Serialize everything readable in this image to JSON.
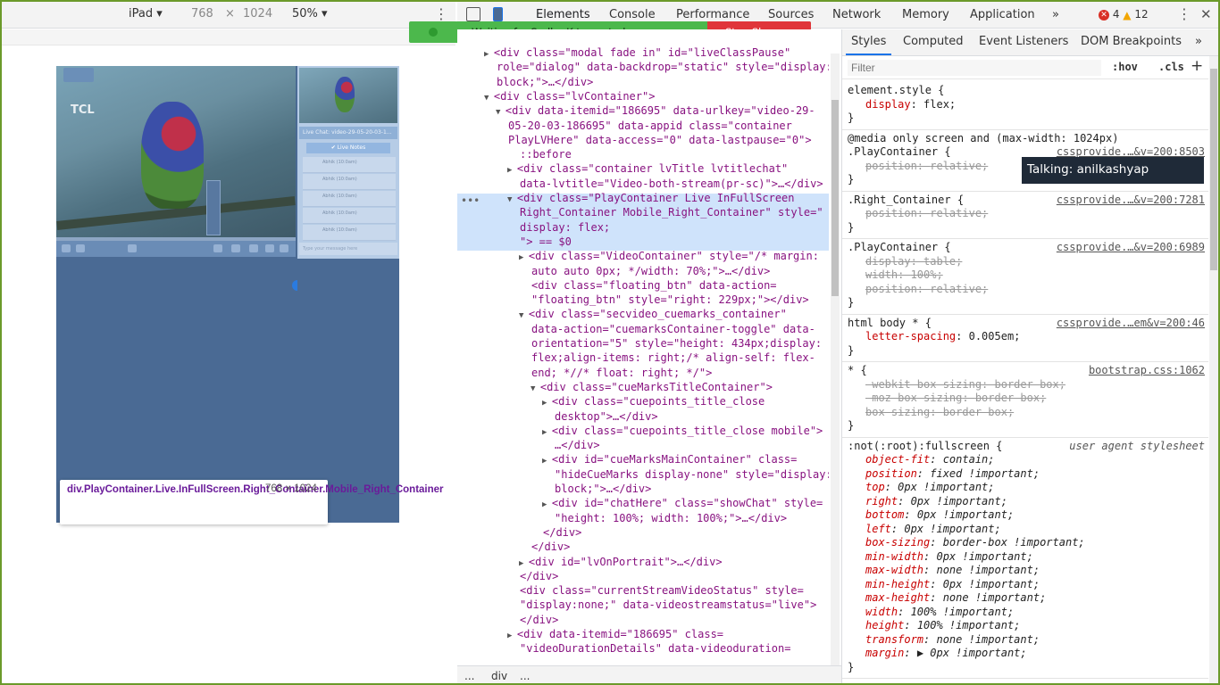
{
  "device_toolbar": {
    "device": "iPad ▾",
    "width": "768",
    "times": "×",
    "height": "1024",
    "zoom": "50% ▾",
    "menu": "⋮"
  },
  "viewport": {
    "logo": "TCL",
    "chat_header": "Live Chat: video-29-05-20-03-1...",
    "chat_button": "✔ Live Notes",
    "chat_items": [
      "Abhik (10:0am)",
      "Abhik (10:0am)",
      "Abhik (10:0am)",
      "Abhik (10:0am)",
      "Abhik (10:0am)"
    ],
    "chat_input": "Type your message here",
    "tooltip_selector": "div.PlayContainer.Live.InFullScreen.Right_Container.Mobile_Right_Container",
    "tooltip_size": "768 × 1024"
  },
  "devtools": {
    "tabs": [
      "Elements",
      "Console",
      "Performance",
      "Sources",
      "Network",
      "Memory",
      "Application"
    ],
    "more": "»",
    "errors": "4",
    "warnings": "12",
    "menu": "⋮",
    "close": "✕"
  },
  "share_banner": {
    "message": "Waiting for Sudha K to control your screen",
    "stop_label": "Stop Share"
  },
  "elements_lines": [
    {
      "indent": 0,
      "tri": "▶",
      "html": "<div class=\"modal fade in\" id=\"liveClassPause\""
    },
    {
      "indent": 0,
      "tri": "",
      "html": "role=\"dialog\" data-backdrop=\"static\" style=\"display:"
    },
    {
      "indent": 0,
      "tri": "",
      "html": "block;\">…</div>"
    },
    {
      "indent": 0,
      "tri": "▼",
      "html": "<div class=\"lvContainer\">"
    },
    {
      "indent": 1,
      "tri": "▼",
      "html": "<div data-itemid=\"186695\" data-urlkey=\"video-29-"
    },
    {
      "indent": 1,
      "tri": "",
      "html": "05-20-03-186695\" data-appid class=\"container"
    },
    {
      "indent": 1,
      "tri": "",
      "html": "PlayLVHere\" data-access=\"0\" data-lastpause=\"0\">"
    },
    {
      "indent": 2,
      "tri": "",
      "html": "::before"
    },
    {
      "indent": 2,
      "tri": "▶",
      "html": "<div class=\"container lvTitle lvtitlechat\""
    },
    {
      "indent": 2,
      "tri": "",
      "html": "data-lvtitle=\"Video-both-stream(pr-sc)\">…</div>"
    },
    {
      "indent": 2,
      "tri": "▼",
      "html": "<div class=\"PlayContainer Live InFullScreen"
    },
    {
      "indent": 2,
      "tri": "",
      "html": "Right_Container Mobile_Right_Container\" style=\""
    },
    {
      "indent": 2,
      "tri": "",
      "html": "    display: flex;"
    },
    {
      "indent": 2,
      "tri": "",
      "html": "\"> == $0"
    },
    {
      "indent": 3,
      "tri": "▶",
      "html": "<div class=\"VideoContainer\" style=\"/* margin:"
    },
    {
      "indent": 3,
      "tri": "",
      "html": "auto auto 0px; */width: 70%;\">…</div>"
    },
    {
      "indent": 3,
      "tri": "",
      "html": "<div class=\"floating_btn\" data-action="
    },
    {
      "indent": 3,
      "tri": "",
      "html": "\"floating_btn\" style=\"right: 229px;\"></div>"
    },
    {
      "indent": 3,
      "tri": "▼",
      "html": "<div class=\"secvideo_cuemarks_container\""
    },
    {
      "indent": 3,
      "tri": "",
      "html": "data-action=\"cuemarksContainer-toggle\" data-"
    },
    {
      "indent": 3,
      "tri": "",
      "html": "orientation=\"5\" style=\"height: 434px;display:"
    },
    {
      "indent": 3,
      "tri": "",
      "html": "flex;align-items: right;/* align-self: flex-"
    },
    {
      "indent": 3,
      "tri": "",
      "html": "end; *//* float: right; */\">"
    },
    {
      "indent": 4,
      "tri": "▼",
      "html": "<div class=\"cueMarksTitleContainer\">"
    },
    {
      "indent": 5,
      "tri": "▶",
      "html": "<div class=\"cuepoints_title_close"
    },
    {
      "indent": 5,
      "tri": "",
      "html": "desktop\">…</div>"
    },
    {
      "indent": 5,
      "tri": "▶",
      "html": "<div class=\"cuepoints_title_close mobile\">"
    },
    {
      "indent": 5,
      "tri": "",
      "html": "…</div>"
    },
    {
      "indent": 5,
      "tri": "▶",
      "html": "<div id=\"cueMarksMainContainer\" class="
    },
    {
      "indent": 5,
      "tri": "",
      "html": "\"hideCueMarks display-none\" style=\"display:"
    },
    {
      "indent": 5,
      "tri": "",
      "html": "block;\">…</div>"
    },
    {
      "indent": 5,
      "tri": "▶",
      "html": "<div id=\"chatHere\" class=\"showChat\" style="
    },
    {
      "indent": 5,
      "tri": "",
      "html": "\"height: 100%; width: 100%;\">…</div>"
    },
    {
      "indent": 4,
      "tri": "",
      "html": "</div>"
    },
    {
      "indent": 3,
      "tri": "",
      "html": "</div>"
    },
    {
      "indent": 3,
      "tri": "▶",
      "html": "<div id=\"lvOnPortrait\">…</div>"
    },
    {
      "indent": 2,
      "tri": "",
      "html": "</div>"
    },
    {
      "indent": 2,
      "tri": "",
      "html": "<div class=\"currentStreamVideoStatus\" style="
    },
    {
      "indent": 2,
      "tri": "",
      "html": "\"display:none;\" data-videostreamstatus=\"live\">"
    },
    {
      "indent": 2,
      "tri": "",
      "html": "</div>"
    },
    {
      "indent": 2,
      "tri": "▶",
      "html": "<div data-itemid=\"186695\" class="
    },
    {
      "indent": 2,
      "tri": "",
      "html": "\"videoDurationDetails\" data-videoduration="
    }
  ],
  "breadcrumb": {
    "dots_left": "...",
    "current": "div",
    "dots_right": "..."
  },
  "styles_tabs": [
    "Styles",
    "Computed",
    "Event Listeners",
    "DOM Breakpoints"
  ],
  "styles_more": "»",
  "filter": {
    "placeholder": "Filter",
    "hov": ":hov",
    "cls": ".cls",
    "add": "+"
  },
  "talking_tooltip": "Talking: anilkashyap",
  "style_rules": [
    {
      "selector": "element.style {",
      "source": "",
      "decls": [
        {
          "k": "display",
          "v": "flex;",
          "strike": false
        }
      ]
    },
    {
      "selector": "@media only screen and (max-width: 1024px)",
      "selector2": ".PlayContainer {",
      "source": "cssprovide.…&v=200:8503",
      "decls": [
        {
          "k": "position",
          "v": "relative;",
          "strike": true
        }
      ]
    },
    {
      "selector": ".Right_Container {",
      "source": "cssprovide.…&v=200:7281",
      "decls": [
        {
          "k": "position",
          "v": "relative;",
          "strike": true
        }
      ]
    },
    {
      "selector": ".PlayContainer {",
      "source": "cssprovide.…&v=200:6989",
      "decls": [
        {
          "k": "display",
          "v": "table;",
          "strike": true
        },
        {
          "k": "width",
          "v": "100%;",
          "strike": true
        },
        {
          "k": "position",
          "v": "relative;",
          "strike": true
        }
      ]
    },
    {
      "selector": "html body * {",
      "source": "cssprovide.…em&v=200:46",
      "decls": [
        {
          "k": "letter-spacing",
          "v": "0.005em;",
          "strike": false
        }
      ]
    },
    {
      "selector": "* {",
      "source": "bootstrap.css:1062",
      "decls": [
        {
          "k": "-webkit-box-sizing",
          "v": "border-box;",
          "strike": true
        },
        {
          "k": "-moz-box-sizing",
          "v": "border-box;",
          "strike": true
        },
        {
          "k": "box-sizing",
          "v": "border-box;",
          "strike": true
        }
      ]
    },
    {
      "selector": ":not(:root):fullscreen {",
      "source": "user agent stylesheet",
      "ua": true,
      "decls": [
        {
          "k": "object-fit",
          "v": "contain;"
        },
        {
          "k": "position",
          "v": "fixed !important;"
        },
        {
          "k": "top",
          "v": "0px !important;"
        },
        {
          "k": "right",
          "v": "0px !important;"
        },
        {
          "k": "bottom",
          "v": "0px !important;"
        },
        {
          "k": "left",
          "v": "0px !important;"
        },
        {
          "k": "box-sizing",
          "v": "border-box !important;"
        },
        {
          "k": "min-width",
          "v": "0px !important;"
        },
        {
          "k": "max-width",
          "v": "none !important;"
        },
        {
          "k": "min-height",
          "v": "0px !important;"
        },
        {
          "k": "max-height",
          "v": "none !important;"
        },
        {
          "k": "width",
          "v": "100% !important;"
        },
        {
          "k": "height",
          "v": "100% !important;"
        },
        {
          "k": "transform",
          "v": "none !important;"
        },
        {
          "k": "margin",
          "v": "▶ 0px !important;"
        }
      ]
    }
  ]
}
